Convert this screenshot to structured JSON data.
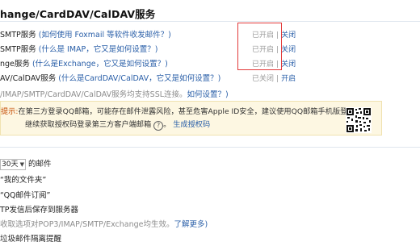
{
  "section_title": "hange/CardDAV/CalDAV服务",
  "services": [
    {
      "name": "SMTP服务",
      "help": "(如何使用 Foxmail 等软件收发邮件？)",
      "status_on": "已开启",
      "sep": "|",
      "action": "关闭"
    },
    {
      "name": "SMTP服务",
      "help": "(什么是 IMAP，它又是如何设置？)",
      "status_on": "已开启",
      "sep": "|",
      "action": "关闭"
    },
    {
      "name": "nge服务",
      "help": "(什么是Exchange，它又是如何设置？)",
      "status_on": "已开启",
      "sep": "|",
      "action": "关闭"
    },
    {
      "name": "AV/CalDAV服务",
      "help": "(什么是CardDAV/CalDAV，它又是如何设置？)",
      "status_on": "已关闭",
      "sep": "|",
      "action": "开启"
    }
  ],
  "ssl_note": {
    "text": "/IMAP/SMTP/CardDAV/CalDAV服务均支持SSL连接。",
    "link": "如何设置？)"
  },
  "warning": {
    "label": "提示:",
    "line1": "在第三方登录QQ邮箱，可能存在邮件泄露风险，甚至危害Apple ID安全，建议使用QQ邮箱手机版登录。",
    "line2": "继续获取授权码登录第三方客户端邮箱",
    "help_glyph": "?",
    "link": "生成授权码",
    "qr_icon": "qr-code-icon"
  },
  "options": {
    "days_select": "30天",
    "days_suffix": "的邮件",
    "folder_mine": "“我的文件夹”",
    "folder_subscribe": "“QQ邮件订阅”",
    "smtp_save": "TP发信后保存到服务器",
    "pop_note": "收取选项对POP3/IMAP/SMTP/Exchange均生效。",
    "learn_more": "了解更多)",
    "spam_filter": "垃圾邮件隔离提醒"
  },
  "colors": {
    "link": "#2a5fa8",
    "highlight_box": "#e23a3a",
    "warning_bg": "#fdf7e2",
    "muted": "#8c8c8c"
  }
}
